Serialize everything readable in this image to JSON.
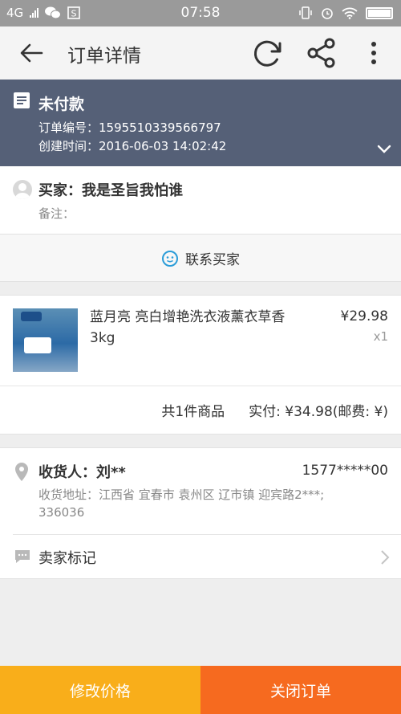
{
  "status_bar": {
    "network": "4G",
    "time": "07:58"
  },
  "header": {
    "title": "订单详情",
    "back_icon": "arrow-left-icon",
    "refresh_icon": "refresh-icon",
    "share_icon": "share-icon",
    "more_icon": "more-vertical-icon"
  },
  "order": {
    "status": "未付款",
    "order_no": "订单编号：1595510339566797",
    "created": "创建时间：2016-06-03 14:02:42",
    "bg_color": "#556077"
  },
  "buyer": {
    "name": "买家：我是圣旨我怕谁",
    "remark": "备注："
  },
  "contact": {
    "label": "联系买家",
    "icon_color": "#2a9cd8"
  },
  "product": {
    "name": "蓝月亮 亮白增艳洗衣液薰衣草香 3kg",
    "price": "¥29.98",
    "qty": "x1",
    "count_text": "共1件商品",
    "paid_text": "实付: ¥34.98(邮费: ¥)"
  },
  "shipping": {
    "receiver": "收货人：刘**",
    "phone": "1577*****00",
    "address": "收货地址：江西省 宜春市 袁州区 辽市镇 迎宾路2***; 336036",
    "seller_mark": "卖家标记"
  },
  "actions": {
    "modify_price": "修改价格",
    "close_order": "关闭订单",
    "left_color": "#f9ae1a",
    "right_color": "#f66a1f"
  }
}
